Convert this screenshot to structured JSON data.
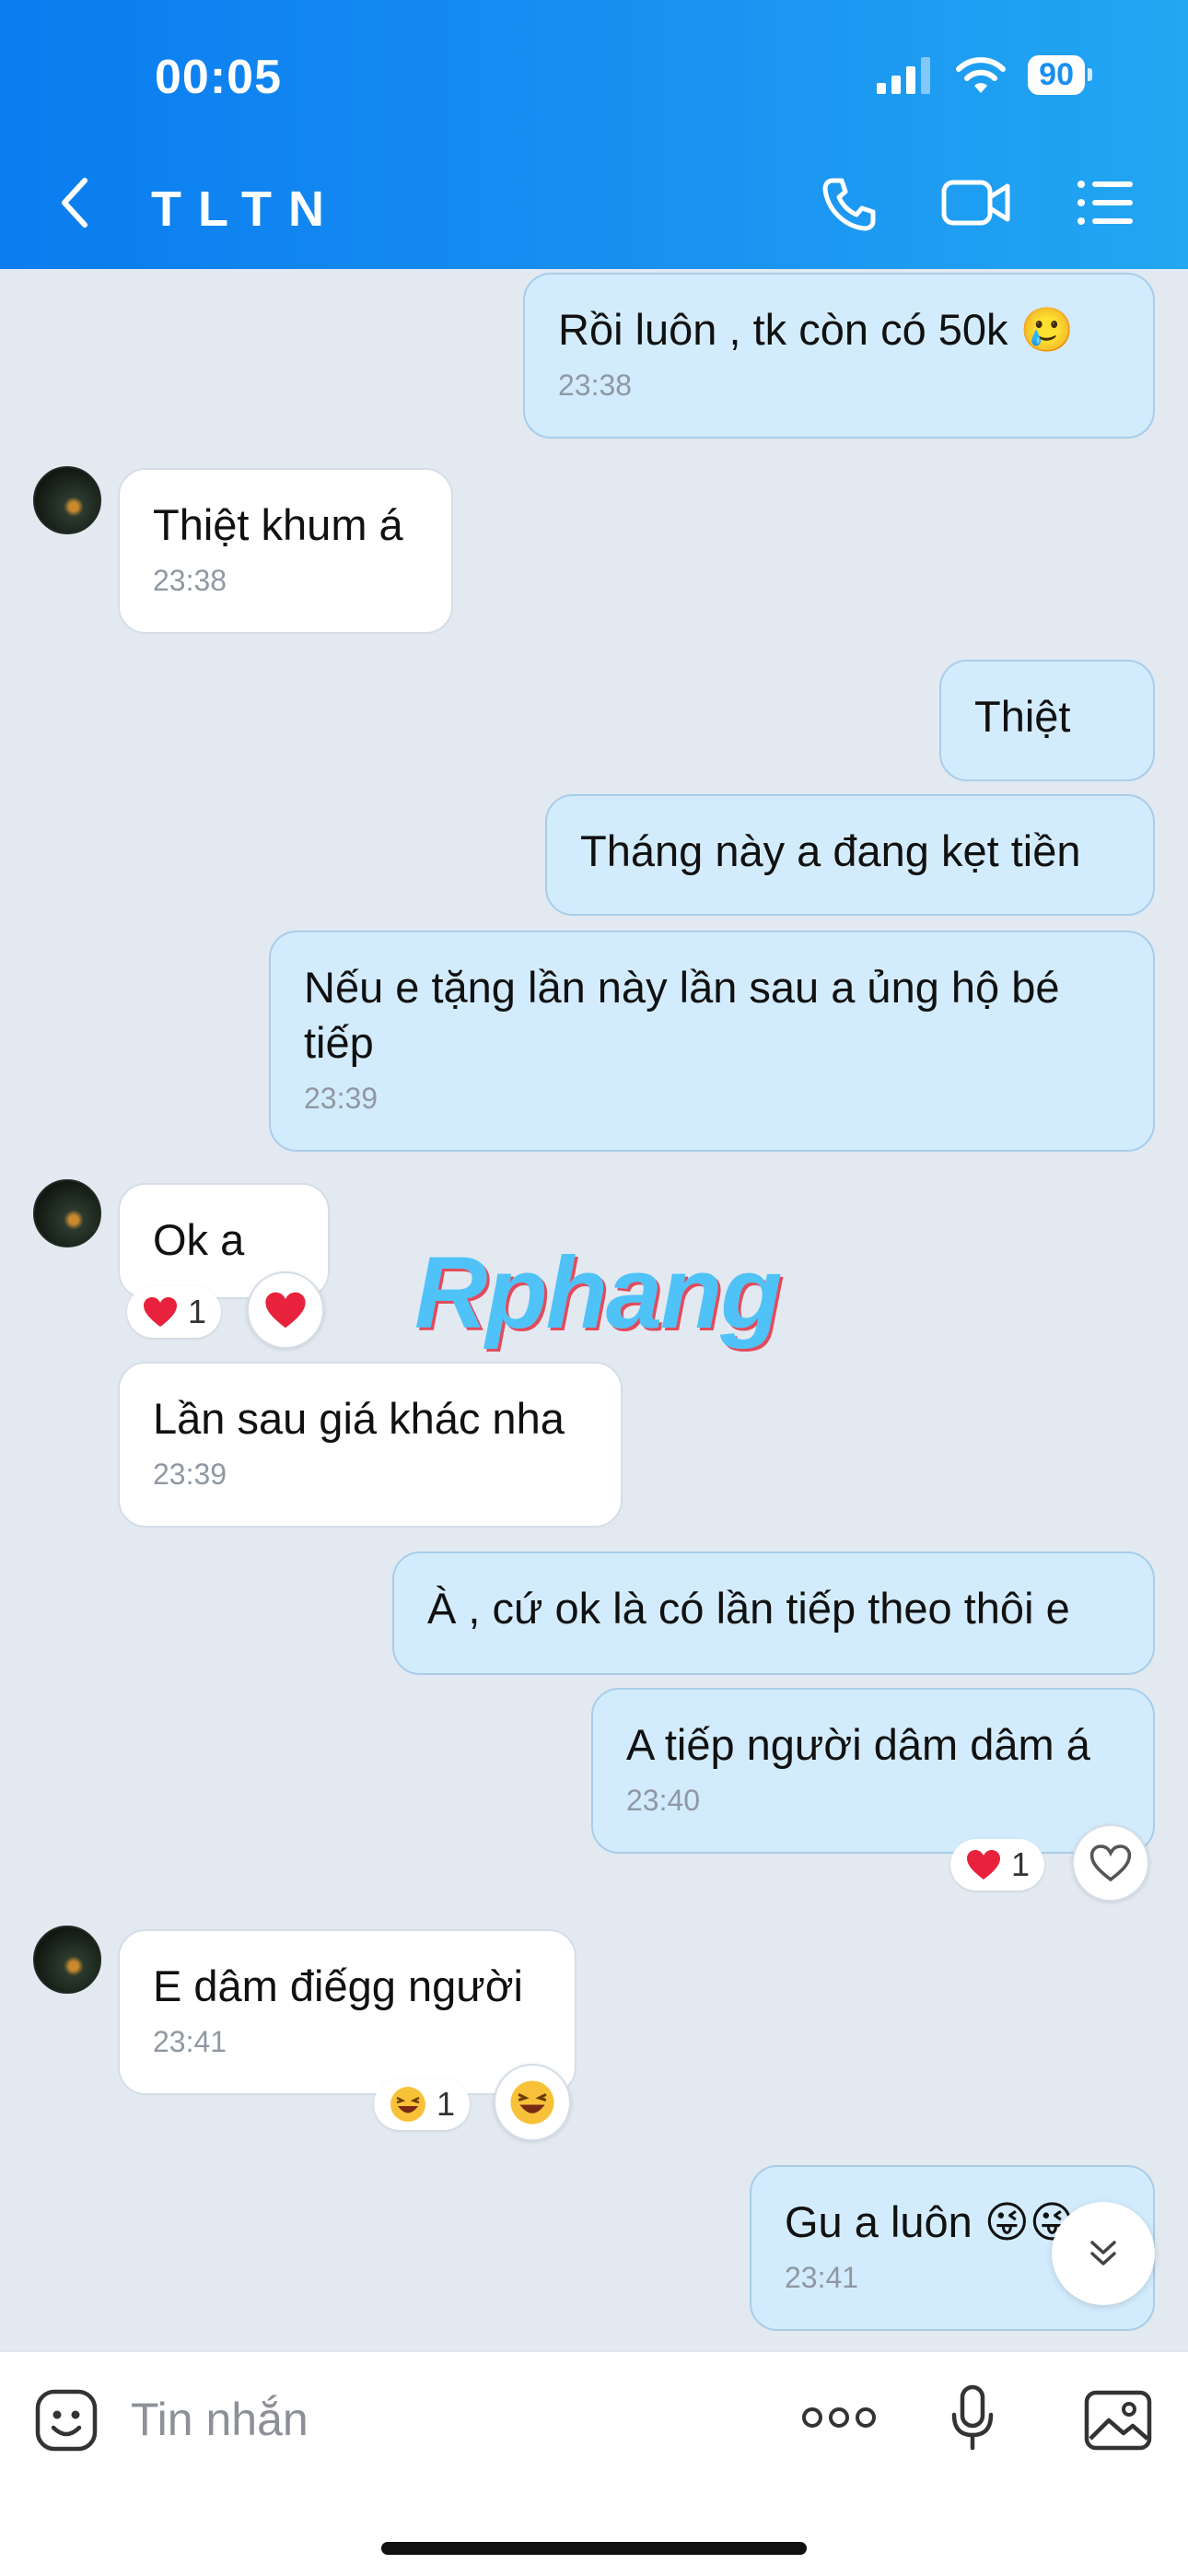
{
  "status_bar": {
    "time": "00:05",
    "battery": "90"
  },
  "header": {
    "title": "TLTN"
  },
  "watermark": "Rphang",
  "messages": [
    {
      "text": "Rồi luôn , tk còn có 50k 🥲",
      "time": "23:38"
    },
    {
      "text": "Thiệt khum á",
      "time": "23:38"
    },
    {
      "text": "Thiệt"
    },
    {
      "text": "Tháng này a đang kẹt tiền"
    },
    {
      "text": "Nếu e tặng lần này lần sau a ủng hộ bé tiếp",
      "time": "23:39"
    },
    {
      "text": "Ok a",
      "reaction_count": "1"
    },
    {
      "text": "Lần sau giá khác nha",
      "time": "23:39"
    },
    {
      "text": "À , cứ ok là có lần tiếp theo thôi e"
    },
    {
      "text": "A tiếp người dâm dâm á",
      "time": "23:40",
      "reaction_count": "1"
    },
    {
      "text": "E dâm điếgg người",
      "time": "23:41",
      "reaction_count": "1"
    },
    {
      "text": "Gu a luôn 😜😜",
      "time": "23:41"
    }
  ],
  "composer": {
    "placeholder": "Tin nhắn"
  },
  "colors": {
    "header_start": "#0a7cf0",
    "header_end": "#22a7f2",
    "outgoing_bubble": "#d3ecfd",
    "incoming_bubble": "#ffffff",
    "chat_bg": "#e2e9f1"
  }
}
